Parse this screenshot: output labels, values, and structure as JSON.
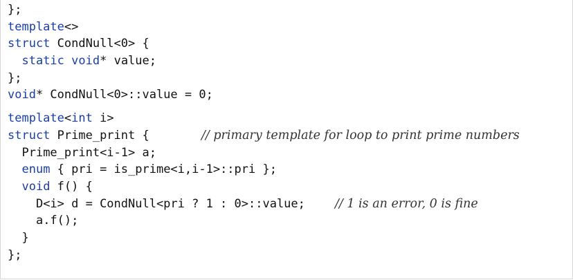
{
  "code": {
    "lines": [
      {
        "text": "};"
      },
      {
        "kw": "template",
        "text": "<>"
      },
      {
        "kw": "struct",
        "text": " CondNull<0> {"
      },
      {
        "indent": "  ",
        "kw": "static",
        "mid": " ",
        "kw2": "void",
        "text": "* value;"
      },
      {
        "text": "};"
      },
      {
        "kw": "void",
        "text": "* CondNull<0>::value = 0;"
      },
      {
        "kw": "template",
        "text": "<",
        "kw2": "int",
        "tail": " i>"
      },
      {
        "kw": "struct",
        "text": " Prime_print {",
        "comment": "// primary template for loop to print prime numbers"
      },
      {
        "indent": "  ",
        "text": "Prime_print<i-1> a;"
      },
      {
        "indent": "  ",
        "kw": "enum",
        "text": " { pri = is_prime<i,i-1>::pri };"
      },
      {
        "indent": "  ",
        "kw": "void",
        "text": " f() {"
      },
      {
        "indent": "    ",
        "text": "D<i> d = CondNull<pri ? 1 : 0>::value;",
        "comment": "// 1 is an error, 0 is fine"
      },
      {
        "indent": "    ",
        "text": "a.f();"
      },
      {
        "indent": "  ",
        "text": "}"
      },
      {
        "text": "};"
      }
    ]
  },
  "colors": {
    "keyword": "#1a3ea8",
    "text": "#111111",
    "comment": "#333333"
  }
}
